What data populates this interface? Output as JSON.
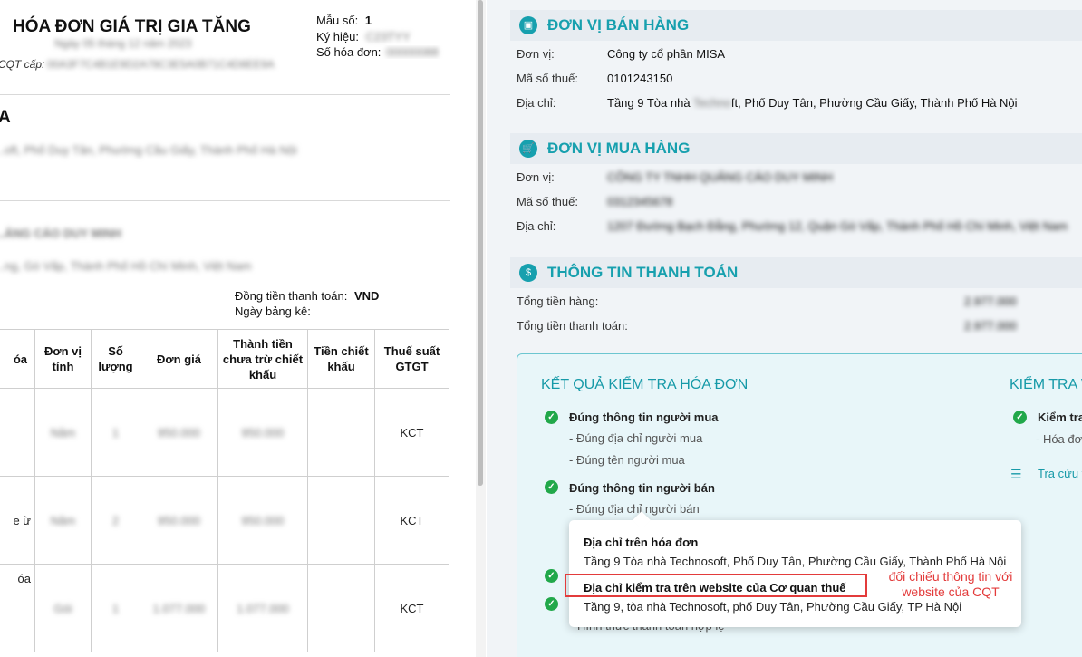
{
  "invoice": {
    "title": "HÓA ĐƠN GIÁ TRỊ GIA TĂNG",
    "date_blur": "Ngày 05 tháng 12 năm 2023",
    "cqt_label": "CQT cấp:",
    "cqt_code_blur": "00A3F7C4B1E9D2A78C3E5A0B71C4D8EE9A",
    "mau_so_label": "Mẫu số:",
    "mau_so_value": "1",
    "ky_hieu_label": "Ký hiệu:",
    "ky_hieu_blur": "C23TYY",
    "so_hd_label": "Số hóa đơn:",
    "so_hd_blur": "00000088",
    "seller_initial": "A",
    "seller_addr_blur": "...oft, Phố Duy Tân, Phường Cầu Giấy, Thành Phố Hà Nội",
    "buyer_name_blur": "...ẢNG CÁO DUY MINH",
    "buyer_addr_blur": "...ng, Gò Vấp, Thành Phố Hồ Chí Minh, Việt Nam",
    "currency_label": "Đồng tiền thanh toán:",
    "currency_value": "VND",
    "statement_label": "Ngày bảng kê:",
    "table": {
      "headers": [
        "óa",
        "Đơn vị tính",
        "Số lượng",
        "Đơn giá",
        "Thành tiền chưa trừ chiết khấu",
        "Tiền chiết khấu",
        "Thuế suất GTGT"
      ],
      "rows": [
        {
          "c0": "",
          "c1": "Năm",
          "c2": "1",
          "c3": "950.000",
          "c4": "950.000",
          "c5": "",
          "tax": "KCT"
        },
        {
          "c0": "e ừ",
          "c1": "Năm",
          "c2": "2",
          "c3": "950.000",
          "c4": "950.000",
          "c5": "",
          "tax": "KCT"
        },
        {
          "c0": "óa",
          "c1": "Gói",
          "c2": "1",
          "c3": "1.077.000",
          "c4": "1.077.000",
          "c5": "",
          "tax": "KCT"
        }
      ]
    }
  },
  "seller": {
    "section_title": "ĐƠN VỊ BÁN HÀNG",
    "unit_label": "Đơn vị:",
    "unit_value": "Công ty cổ phần MISA",
    "tax_label": "Mã số thuế:",
    "tax_value": "0101243150",
    "addr_label": "Địa chỉ:",
    "addr_prefix": "Tầng 9 Tòa nhà",
    "addr_blur": "Techno",
    "addr_suffix": "ft, Phố Duy Tân, Phường Cầu Giấy, Thành Phố Hà Nội"
  },
  "buyer": {
    "section_title": "ĐƠN VỊ MUA HÀNG",
    "unit_label": "Đơn vị:",
    "unit_blur": "CÔNG TY TNHH QUẢNG CÁO DUY MINH",
    "tax_label": "Mã số thuế:",
    "tax_blur": "0312345678",
    "addr_label": "Địa chỉ:",
    "addr_blur": "1207 Đường Bạch Đằng, Phường 12, Quận Gò Vấp, Thành Phố Hồ Chí Minh, Việt Nam"
  },
  "payment": {
    "section_title": "THÔNG TIN THANH TOÁN",
    "goods_label": "Tổng tiền hàng:",
    "goods_blur": "2.977.000",
    "total_label": "Tổng tiền thanh toán:",
    "total_blur": "2.977.000"
  },
  "result": {
    "title": "KẾT QUẢ KIỂM TRA HÓA ĐƠN",
    "buyer_ok": "Đúng thông tin người mua",
    "buyer_addr_ok": "- Đúng địa chỉ người mua",
    "buyer_name_ok": "- Đúng tên người mua",
    "seller_ok": "Đúng thông tin người bán",
    "seller_addr_ok": "- Đúng địa chỉ người bán",
    "payment_form_partial": "Hình thức thanh toán hợp lệ",
    "right_title": "KIỂM TRA V",
    "right_item": "Kiểm tra",
    "right_sub": "- Hóa đơ",
    "right_link": "Tra cứu t"
  },
  "tooltip": {
    "invoice_addr_title": "Địa chỉ trên hóa đơn",
    "invoice_addr_value": "Tầng 9 Tòa nhà Technosoft, Phố Duy Tân, Phường Cầu Giấy, Thành Phố Hà Nội",
    "cqt_addr_title": "Địa chỉ kiểm tra trên website của Cơ quan thuế",
    "cqt_addr_value": "Tầng 9, tòa nhà Technosoft, phố Duy Tân, Phường Cầu Giấy, TP Hà Nội"
  },
  "annotation": {
    "text": "đối chiếu thông tin với website của CQT",
    "color": "#e33b3b"
  },
  "colors": {
    "accent": "#17a0ae",
    "check": "#21a84a"
  }
}
